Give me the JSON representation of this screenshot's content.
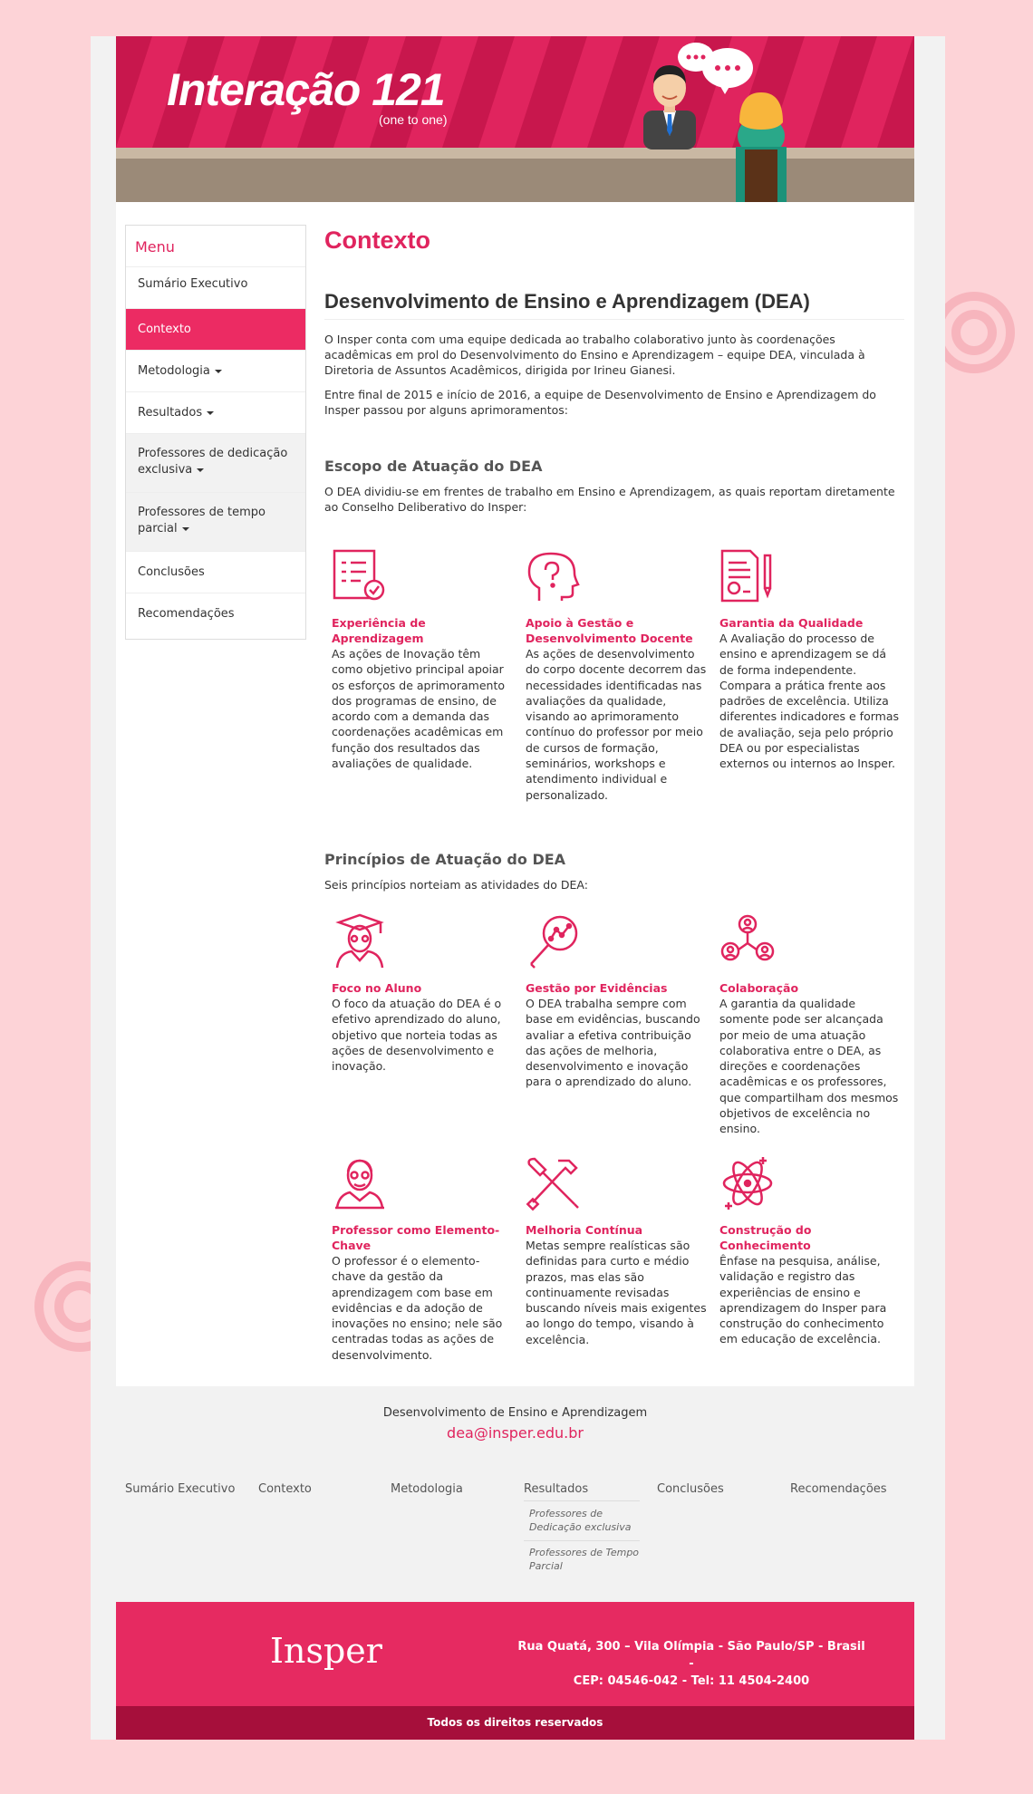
{
  "banner": {
    "title": "Interação 121",
    "subtitle": "(one to one)"
  },
  "sidebar": {
    "title": "Menu",
    "items": [
      {
        "label": "Sumário Executivo"
      },
      {
        "label": "Contexto"
      },
      {
        "label": "Metodologia"
      },
      {
        "label": "Resultados"
      },
      {
        "label": "Professores de dedicação exclusiva"
      },
      {
        "label": "Professores de tempo parcial"
      },
      {
        "label": "Conclusões"
      },
      {
        "label": "Recomendações"
      }
    ]
  },
  "main": {
    "title": "Contexto",
    "subtitle": "Desenvolvimento de Ensino e Aprendizagem (DEA)",
    "intro1": "O Insper conta com uma equipe dedicada ao trabalho colaborativo junto às coordenações acadêmicas em prol do Desenvolvimento do Ensino e Aprendizagem – equipe DEA, vinculada à Diretoria de Assuntos Acadêmicos, dirigida por Irineu Gianesi.",
    "intro2": "Entre final de 2015 e início de 2016, a equipe de Desenvolvimento de Ensino e Aprendizagem do Insper passou por alguns aprimoramentos:",
    "scope_title": "Escopo de Atuação do DEA",
    "scope_text": "O DEA dividiu-se em frentes de trabalho em Ensino e Aprendizagem, as quais reportam diretamente ao Conselho Deliberativo do Insper:",
    "scope_cards": [
      {
        "icon": "checklist-icon",
        "title": "Experiência de Aprendizagem",
        "text": "As ações de Inovação têm como objetivo principal apoiar os esforços de aprimoramento dos programas de ensino, de acordo com a demanda das coordenações acadêmicas em função dos resultados das avaliações de qualidade."
      },
      {
        "icon": "question-head-icon",
        "title": "Apoio à Gestão e Desenvolvimento Docente",
        "text": "As ações de desenvolvimento do corpo docente decorrem das necessidades identificadas nas avaliações da qualidade, visando ao aprimoramento contínuo do professor por meio de cursos de formação, seminários, workshops e atendimento individual e personalizado."
      },
      {
        "icon": "certificate-icon",
        "title": "Garantia da Qualidade",
        "text": "A Avaliação do processo de ensino e aprendizagem se dá de forma independente. Compara a prática frente aos padrões de excelência. Utiliza diferentes indicadores e formas de avaliação, seja pelo próprio DEA ou por especialistas externos ou internos ao Insper."
      }
    ],
    "principles_title": "Princípios de Atuação do DEA",
    "principles_text": "Seis princípios norteiam as atividades do DEA:",
    "principle_cards": [
      {
        "icon": "graduate-icon",
        "title": "Foco no Aluno",
        "text": "O foco da atuação do DEA é o efetivo aprendizado do aluno, objetivo que norteia todas as ações de desenvolvimento e inovação."
      },
      {
        "icon": "magnifier-chart-icon",
        "title": "Gestão por Evidências",
        "text": "O DEA trabalha sempre com base em evidências, buscando avaliar a efetiva contribuição das ações de melhoria, desenvolvimento e inovação para o aprendizado do aluno."
      },
      {
        "icon": "people-network-icon",
        "title": "Colaboração",
        "text": "A garantia da qualidade somente pode ser alcançada por meio de uma atuação colaborativa entre o DEA, as direções e coordenações acadêmicas e os professores, que compartilham dos mesmos objetivos de excelência no ensino."
      },
      {
        "icon": "professor-icon",
        "title": "Professor como Elemento-Chave",
        "text": "O professor é o elemento-chave da gestão da aprendizagem com base em evidências e da adoção de inovações no ensino; nele são centradas todas as ações de desenvolvimento."
      },
      {
        "icon": "tools-icon",
        "title": "Melhoria Contínua",
        "text": "Metas sempre realísticas são definidas para curto e médio prazos, mas elas são continuamente revisadas buscando níveis mais exigentes ao longo do tempo, visando à excelência."
      },
      {
        "icon": "atom-icon",
        "title": "Construção do Conhecimento",
        "text": "Ênfase na pesquisa, análise, validação e registro das experiências de ensino e aprendizagem do Insper para construção do conhecimento em educação de excelência."
      }
    ]
  },
  "footer": {
    "department": "Desenvolvimento de Ensino e Aprendizagem",
    "email": "dea@insper.edu.br",
    "nav": [
      "Sumário Executivo",
      "Contexto",
      "Metodologia",
      "Resultados",
      "Conclusões",
      "Recomendações"
    ],
    "sub_results": [
      "Professores de Dedicação exclusiva",
      "Professores de Tempo Parcial"
    ],
    "logo": "Insper",
    "address_line1": "Rua Quatá, 300 – Vila Olímpia - São Paulo/SP - Brasil -",
    "address_line2": "CEP: 04546-042 - Tel: 11 4504-2400",
    "rights": "Todos os direitos reservados"
  },
  "colors": {
    "accent": "#e0245e",
    "dark_accent": "#a60f3b",
    "background": "#fdd3d7"
  }
}
